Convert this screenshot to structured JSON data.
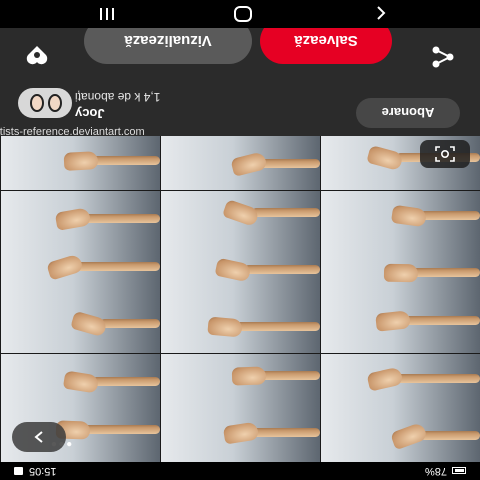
{
  "status_bar": {
    "battery": "78%",
    "time": "15:05"
  },
  "watermark": "artists-reference.deviantart.com",
  "grid": {
    "more_label": ">",
    "dots": "•••"
  },
  "user": {
    "name": "Jocy",
    "followers": "1,4 k de abonați"
  },
  "subscribe_label": "Abonare",
  "actions": {
    "save_label": "Salvează",
    "view_label": "Vizualizează"
  },
  "colors": {
    "save": "#e60023",
    "view": "#5a5a5a",
    "background": "#2b2b2b"
  },
  "icons": [
    "share-icon",
    "heart-icon",
    "lens-icon",
    "back-icon",
    "home-icon",
    "recent-apps-icon"
  ]
}
